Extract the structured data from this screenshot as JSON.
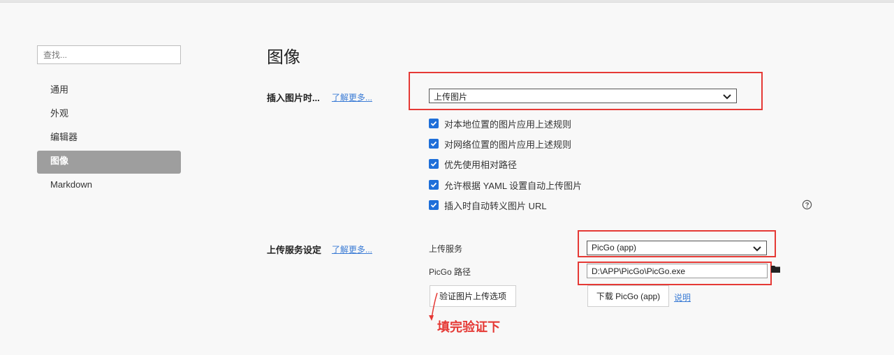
{
  "sidebar": {
    "search_placeholder": "查找...",
    "items": [
      {
        "label": "通用"
      },
      {
        "label": "外观"
      },
      {
        "label": "编辑器"
      },
      {
        "label": "图像",
        "active": true
      },
      {
        "label": "Markdown"
      }
    ]
  },
  "page": {
    "title": "图像"
  },
  "insert_image": {
    "label": "插入图片时...",
    "learn_more": "了解更多...",
    "action_selected": "上传图片",
    "checkboxes": [
      {
        "label": "对本地位置的图片应用上述规则",
        "checked": true
      },
      {
        "label": "对网络位置的图片应用上述规则",
        "checked": true
      },
      {
        "label": "优先使用相对路径",
        "checked": true
      },
      {
        "label": "允许根据 YAML 设置自动上传图片",
        "checked": true
      },
      {
        "label": "插入时自动转义图片 URL",
        "checked": true
      }
    ]
  },
  "upload_service": {
    "label": "上传服务设定",
    "learn_more": "了解更多...",
    "service_label": "上传服务",
    "service_selected": "PicGo (app)",
    "path_label": "PicGo 路径",
    "path_value": "D:\\APP\\PicGo\\PicGo.exe",
    "verify_button": "验证图片上传选项",
    "download_button": "下载 PicGo (app)",
    "help_link": "说明"
  },
  "annotation": {
    "note": "填完验证下"
  },
  "colors": {
    "accent": "#1e6fd9",
    "highlight": "#e53935",
    "active_nav": "#9e9e9e"
  },
  "icons": [
    "chevron-down-icon",
    "checkmark-icon",
    "help-circle-icon",
    "folder-icon",
    "arrow-down-icon"
  ]
}
